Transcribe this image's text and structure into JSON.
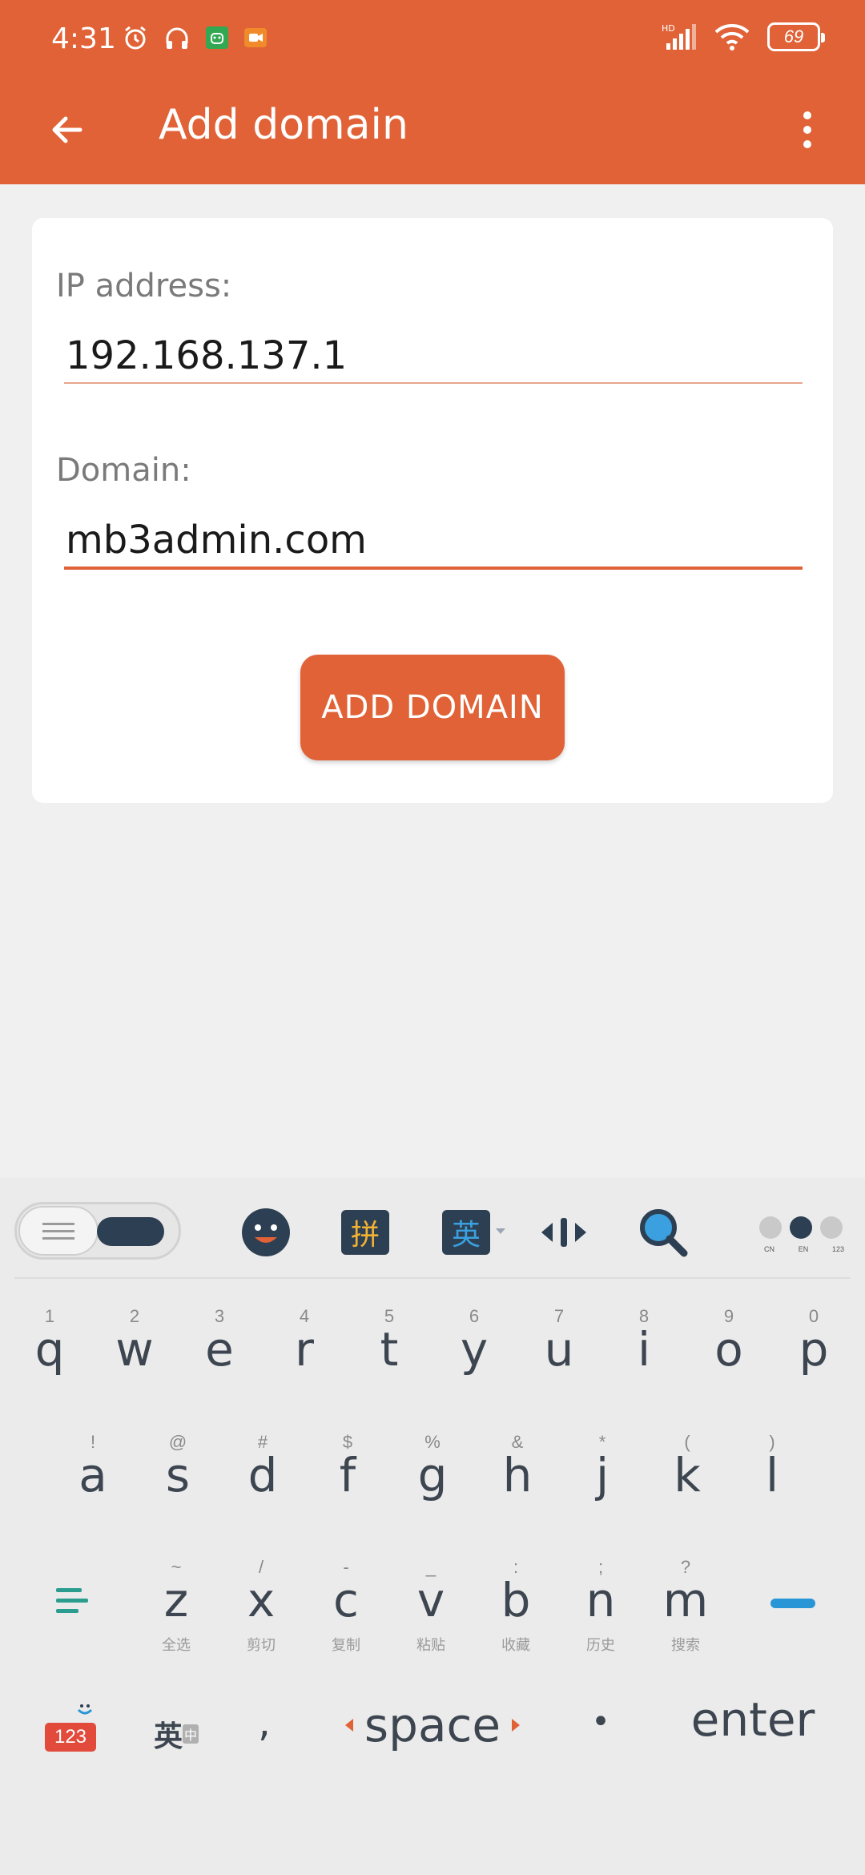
{
  "status_bar": {
    "time": "4:31",
    "battery": "69",
    "network": "HD"
  },
  "toolbar": {
    "title": "Add domain",
    "back_icon": "arrow-left-icon",
    "menu_icon": "more-vert-icon"
  },
  "form": {
    "ip_label": "IP address:",
    "ip_value": "192.168.137.1",
    "domain_label": "Domain:",
    "domain_value": "mb3admin.com",
    "submit_label": "ADD DOMAIN"
  },
  "colors": {
    "accent": "#e06236",
    "background": "#f0f0f0",
    "keyboard_dark": "#2d3f52"
  },
  "keyboard": {
    "toolbar": {
      "pinyin": "拼",
      "english": "英",
      "lang_dots": [
        "CN",
        "EN",
        "123"
      ]
    },
    "row1": [
      {
        "hint": "1",
        "ch": "q"
      },
      {
        "hint": "2",
        "ch": "w"
      },
      {
        "hint": "3",
        "ch": "e"
      },
      {
        "hint": "4",
        "ch": "r"
      },
      {
        "hint": "5",
        "ch": "t"
      },
      {
        "hint": "6",
        "ch": "y"
      },
      {
        "hint": "7",
        "ch": "u"
      },
      {
        "hint": "8",
        "ch": "i"
      },
      {
        "hint": "9",
        "ch": "o"
      },
      {
        "hint": "0",
        "ch": "p"
      }
    ],
    "row2": [
      {
        "hint": "!",
        "ch": "a"
      },
      {
        "hint": "@",
        "ch": "s"
      },
      {
        "hint": "#",
        "ch": "d"
      },
      {
        "hint": "$",
        "ch": "f"
      },
      {
        "hint": "%",
        "ch": "g"
      },
      {
        "hint": "&",
        "ch": "h"
      },
      {
        "hint": "*",
        "ch": "j"
      },
      {
        "hint": "(",
        "ch": "k"
      },
      {
        "hint": ")",
        "ch": "l"
      }
    ],
    "row3": [
      {
        "hint": "~",
        "ch": "z",
        "sub": "全选"
      },
      {
        "hint": "/",
        "ch": "x",
        "sub": "剪切"
      },
      {
        "hint": "-",
        "ch": "c",
        "sub": "复制"
      },
      {
        "hint": "_",
        "ch": "v",
        "sub": "粘贴"
      },
      {
        "hint": ":",
        "ch": "b",
        "sub": "收藏"
      },
      {
        "hint": ";",
        "ch": "n",
        "sub": "历史"
      },
      {
        "hint": "?",
        "ch": "m",
        "sub": "搜索"
      }
    ],
    "bottom": {
      "num": "123",
      "lang": "英",
      "lang_small": "中",
      "comma": ",",
      "space": "space",
      "period": "•",
      "enter": "enter"
    }
  }
}
